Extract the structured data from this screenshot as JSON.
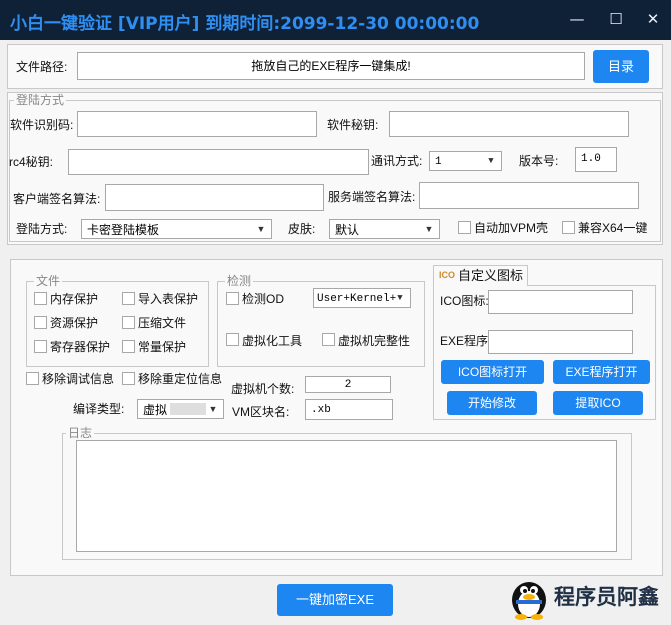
{
  "window": {
    "title": "小白一键验证  [VIP用户]  到期时间:2099-12-30 00:00:00",
    "min_icon": "—",
    "max_icon": "☐",
    "close_icon": "✕"
  },
  "file_path": {
    "label": "文件路径:",
    "value": "拖放自己的EXE程序一键集成!",
    "browse_button": "目录"
  },
  "login_group": {
    "legend": "登陆方式",
    "software_id_label": "软件识别码:",
    "software_id_value": "",
    "software_secret_label": "软件秘钥:",
    "software_secret_value": "",
    "rc4_label": "rc4秘钥:",
    "rc4_value": "",
    "comm_label": "通讯方式:",
    "comm_value": "1",
    "version_label": "版本号:",
    "version_value": "1.0",
    "client_sign_label": "客户端签名算法:",
    "client_sign_value": "",
    "server_sign_label": "服务端签名算法:",
    "server_sign_value": "",
    "login_mode_label": "登陆方式:",
    "login_mode_value": "卡密登陆模板",
    "skin_label": "皮肤:",
    "skin_value": "默认",
    "auto_vpm_label": "自动加VPM壳",
    "x64_label": "兼容X64一键"
  },
  "file_group": {
    "legend": "文件",
    "memory_protect": "内存保护",
    "import_protect": "导入表保护",
    "resource_protect": "资源保护",
    "compress_file": "压缩文件",
    "register_protect": "寄存器保护",
    "const_protect": "常量保护"
  },
  "detect_group": {
    "legend": "检测",
    "detect_od": "检测OD",
    "detect_mode": "User+Kernel+",
    "vm_tools": "虚拟化工具",
    "vm_integrity": "虚拟机完整性"
  },
  "options": {
    "remove_debug": "移除调试信息",
    "remove_reloc": "移除重定位信息",
    "vm_count_label": "虚拟机个数:",
    "vm_count_value": "2",
    "compile_type_label": "编译类型:",
    "compile_type_value": "虚拟",
    "vm_section_label": "VM区块名:",
    "vm_section_value": ".xb"
  },
  "ico_panel": {
    "tab_badge": "ICO",
    "tab_label": "自定义图标",
    "ico_label": "ICO图标:",
    "ico_value": "",
    "exe_label": "EXE程序:",
    "exe_value": "",
    "open_ico": "ICO图标打开",
    "open_exe": "EXE程序打开",
    "start_modify": "开始修改",
    "extract_ico": "提取ICO"
  },
  "log": {
    "legend": "日志",
    "content": ""
  },
  "encrypt_button": "一键加密EXE",
  "author": "程序员阿鑫",
  "colors": {
    "accent": "#1e86f0",
    "titlebar": "#0f2137",
    "title_text": "#2f8ef1"
  }
}
